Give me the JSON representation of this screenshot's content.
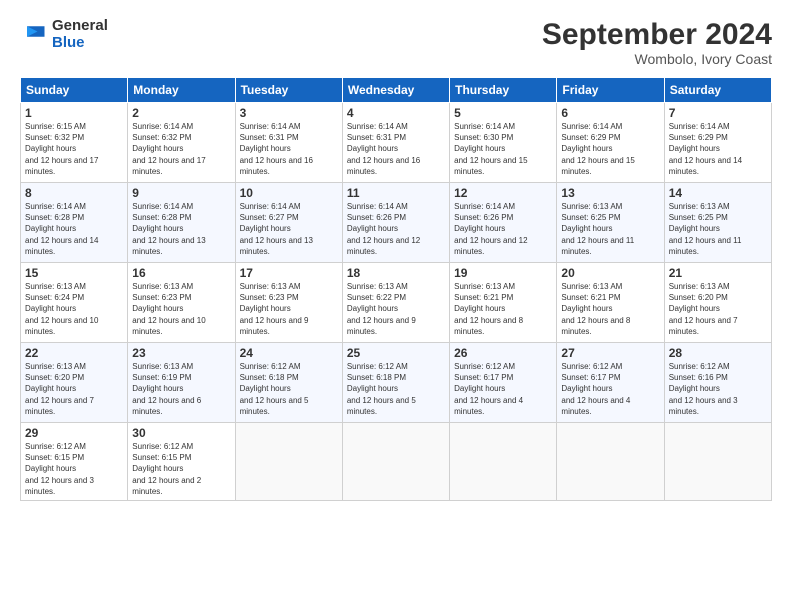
{
  "header": {
    "logo_general": "General",
    "logo_blue": "Blue",
    "month_title": "September 2024",
    "subtitle": "Wombolo, Ivory Coast"
  },
  "days_of_week": [
    "Sunday",
    "Monday",
    "Tuesday",
    "Wednesday",
    "Thursday",
    "Friday",
    "Saturday"
  ],
  "weeks": [
    [
      {
        "day": "1",
        "sunrise": "6:15 AM",
        "sunset": "6:32 PM",
        "daylight": "12 hours and 17 minutes."
      },
      {
        "day": "2",
        "sunrise": "6:14 AM",
        "sunset": "6:32 PM",
        "daylight": "12 hours and 17 minutes."
      },
      {
        "day": "3",
        "sunrise": "6:14 AM",
        "sunset": "6:31 PM",
        "daylight": "12 hours and 16 minutes."
      },
      {
        "day": "4",
        "sunrise": "6:14 AM",
        "sunset": "6:31 PM",
        "daylight": "12 hours and 16 minutes."
      },
      {
        "day": "5",
        "sunrise": "6:14 AM",
        "sunset": "6:30 PM",
        "daylight": "12 hours and 15 minutes."
      },
      {
        "day": "6",
        "sunrise": "6:14 AM",
        "sunset": "6:29 PM",
        "daylight": "12 hours and 15 minutes."
      },
      {
        "day": "7",
        "sunrise": "6:14 AM",
        "sunset": "6:29 PM",
        "daylight": "12 hours and 14 minutes."
      }
    ],
    [
      {
        "day": "8",
        "sunrise": "6:14 AM",
        "sunset": "6:28 PM",
        "daylight": "12 hours and 14 minutes."
      },
      {
        "day": "9",
        "sunrise": "6:14 AM",
        "sunset": "6:28 PM",
        "daylight": "12 hours and 13 minutes."
      },
      {
        "day": "10",
        "sunrise": "6:14 AM",
        "sunset": "6:27 PM",
        "daylight": "12 hours and 13 minutes."
      },
      {
        "day": "11",
        "sunrise": "6:14 AM",
        "sunset": "6:26 PM",
        "daylight": "12 hours and 12 minutes."
      },
      {
        "day": "12",
        "sunrise": "6:14 AM",
        "sunset": "6:26 PM",
        "daylight": "12 hours and 12 minutes."
      },
      {
        "day": "13",
        "sunrise": "6:13 AM",
        "sunset": "6:25 PM",
        "daylight": "12 hours and 11 minutes."
      },
      {
        "day": "14",
        "sunrise": "6:13 AM",
        "sunset": "6:25 PM",
        "daylight": "12 hours and 11 minutes."
      }
    ],
    [
      {
        "day": "15",
        "sunrise": "6:13 AM",
        "sunset": "6:24 PM",
        "daylight": "12 hours and 10 minutes."
      },
      {
        "day": "16",
        "sunrise": "6:13 AM",
        "sunset": "6:23 PM",
        "daylight": "12 hours and 10 minutes."
      },
      {
        "day": "17",
        "sunrise": "6:13 AM",
        "sunset": "6:23 PM",
        "daylight": "12 hours and 9 minutes."
      },
      {
        "day": "18",
        "sunrise": "6:13 AM",
        "sunset": "6:22 PM",
        "daylight": "12 hours and 9 minutes."
      },
      {
        "day": "19",
        "sunrise": "6:13 AM",
        "sunset": "6:21 PM",
        "daylight": "12 hours and 8 minutes."
      },
      {
        "day": "20",
        "sunrise": "6:13 AM",
        "sunset": "6:21 PM",
        "daylight": "12 hours and 8 minutes."
      },
      {
        "day": "21",
        "sunrise": "6:13 AM",
        "sunset": "6:20 PM",
        "daylight": "12 hours and 7 minutes."
      }
    ],
    [
      {
        "day": "22",
        "sunrise": "6:13 AM",
        "sunset": "6:20 PM",
        "daylight": "12 hours and 7 minutes."
      },
      {
        "day": "23",
        "sunrise": "6:13 AM",
        "sunset": "6:19 PM",
        "daylight": "12 hours and 6 minutes."
      },
      {
        "day": "24",
        "sunrise": "6:12 AM",
        "sunset": "6:18 PM",
        "daylight": "12 hours and 5 minutes."
      },
      {
        "day": "25",
        "sunrise": "6:12 AM",
        "sunset": "6:18 PM",
        "daylight": "12 hours and 5 minutes."
      },
      {
        "day": "26",
        "sunrise": "6:12 AM",
        "sunset": "6:17 PM",
        "daylight": "12 hours and 4 minutes."
      },
      {
        "day": "27",
        "sunrise": "6:12 AM",
        "sunset": "6:17 PM",
        "daylight": "12 hours and 4 minutes."
      },
      {
        "day": "28",
        "sunrise": "6:12 AM",
        "sunset": "6:16 PM",
        "daylight": "12 hours and 3 minutes."
      }
    ],
    [
      {
        "day": "29",
        "sunrise": "6:12 AM",
        "sunset": "6:15 PM",
        "daylight": "12 hours and 3 minutes."
      },
      {
        "day": "30",
        "sunrise": "6:12 AM",
        "sunset": "6:15 PM",
        "daylight": "12 hours and 2 minutes."
      },
      null,
      null,
      null,
      null,
      null
    ]
  ]
}
